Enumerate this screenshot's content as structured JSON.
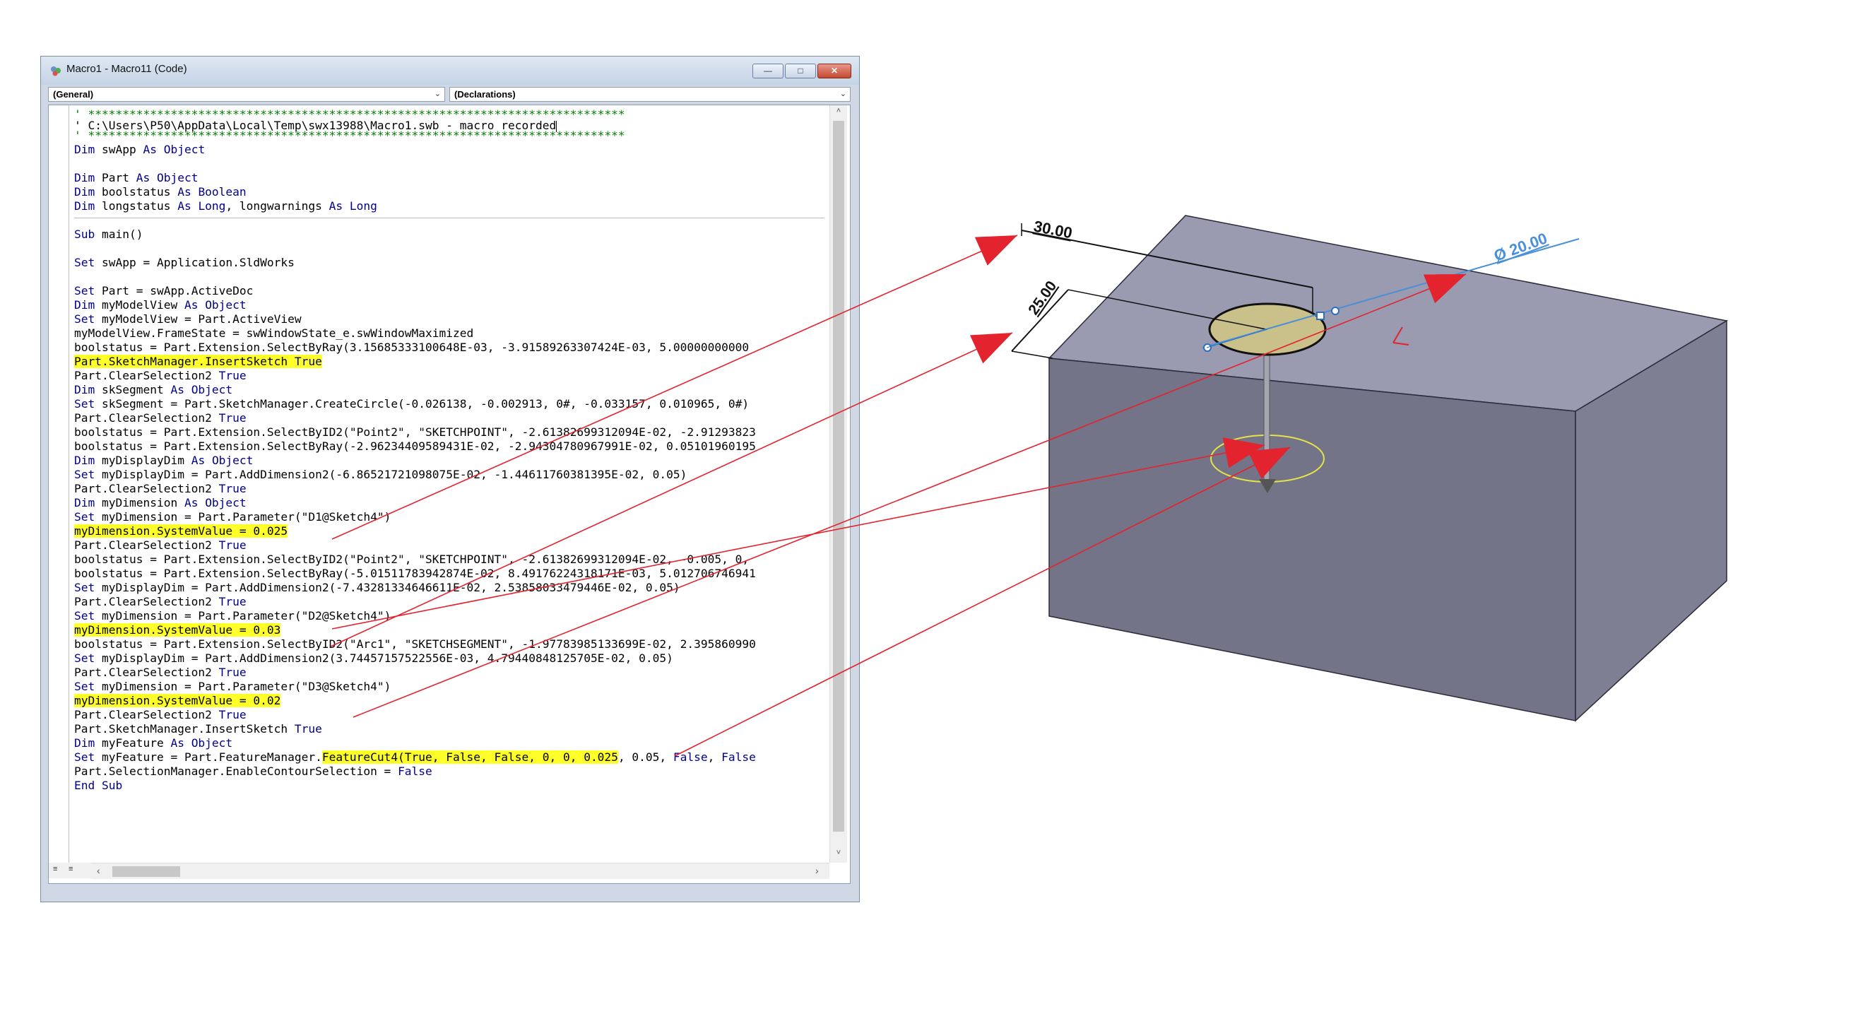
{
  "window": {
    "title": "Macro1 - Macro11 (Code)",
    "minimize_glyph": "—",
    "maximize_glyph": "□",
    "close_glyph": "✕",
    "object_combo": "(General)",
    "procedure_combo": "(Declarations)",
    "combo_arrow": "⌄"
  },
  "code_lines": [
    {
      "text": "' ******************************************************************************",
      "style": "comment"
    },
    {
      "text": "' C:\\Users\\P50\\AppData\\Local\\Temp\\swx13988\\Macro1.swb - macro recorded",
      "style": "plain",
      "cursor": true
    },
    {
      "text": "' ******************************************************************************",
      "style": "comment"
    },
    {
      "segments": [
        [
          "Dim",
          "kw"
        ],
        [
          " swApp ",
          ""
        ],
        [
          "As Object",
          "kw"
        ]
      ]
    },
    {
      "text": "",
      "style": "plain"
    },
    {
      "segments": [
        [
          "Dim",
          "kw"
        ],
        [
          " Part ",
          ""
        ],
        [
          "As Object",
          "kw"
        ]
      ]
    },
    {
      "segments": [
        [
          "Dim",
          "kw"
        ],
        [
          " boolstatus ",
          ""
        ],
        [
          "As Boolean",
          "kw"
        ]
      ]
    },
    {
      "segments": [
        [
          "Dim",
          "kw"
        ],
        [
          " longstatus ",
          ""
        ],
        [
          "As Long",
          "kw"
        ],
        [
          ", longwarnings ",
          ""
        ],
        [
          "As Long",
          "kw"
        ]
      ]
    },
    {
      "text": "",
      "style": "plain"
    },
    {
      "segments": [
        [
          "Sub",
          "kw"
        ],
        [
          " main()",
          ""
        ]
      ]
    },
    {
      "text": "",
      "style": "plain"
    },
    {
      "segments": [
        [
          "Set",
          "kw"
        ],
        [
          " swApp = Application.SldWorks",
          ""
        ]
      ]
    },
    {
      "text": "",
      "style": "plain"
    },
    {
      "segments": [
        [
          "Set",
          "kw"
        ],
        [
          " Part = swApp.ActiveDoc",
          ""
        ]
      ]
    },
    {
      "segments": [
        [
          "Dim",
          "kw"
        ],
        [
          " myModelView ",
          ""
        ],
        [
          "As Object",
          "kw"
        ]
      ]
    },
    {
      "segments": [
        [
          "Set",
          "kw"
        ],
        [
          " myModelView = Part.ActiveView",
          ""
        ]
      ]
    },
    {
      "text": "myModelView.FrameState = swWindowState_e.swWindowMaximized",
      "style": "plain"
    },
    {
      "text": "boolstatus = Part.Extension.SelectByRay(3.15685333100648E-03, -3.91589263307424E-03, 5.00000000000",
      "style": "plain"
    },
    {
      "segments": [
        [
          "Part.SketchManager.InsertSketch ",
          "hl"
        ],
        [
          "True",
          "hl kw"
        ]
      ]
    },
    {
      "segments": [
        [
          "Part.ClearSelection2 ",
          ""
        ],
        [
          "True",
          "kw"
        ]
      ]
    },
    {
      "segments": [
        [
          "Dim",
          "kw"
        ],
        [
          " skSegment ",
          ""
        ],
        [
          "As Object",
          "kw"
        ]
      ]
    },
    {
      "segments": [
        [
          "Set",
          "kw"
        ],
        [
          " skSegment = Part.SketchManager.CreateCircle(-0.026138, -0.002913, 0#, -0.033157, 0.010965, 0#)",
          ""
        ]
      ]
    },
    {
      "segments": [
        [
          "Part.ClearSelection2 ",
          ""
        ],
        [
          "True",
          "kw"
        ]
      ]
    },
    {
      "text": "boolstatus = Part.Extension.SelectByID2(\"Point2\", \"SKETCHPOINT\", -2.61382699312094E-02, -2.91293823",
      "style": "plain"
    },
    {
      "text": "boolstatus = Part.Extension.SelectByRay(-2.96234409589431E-02, -2.94304780967991E-02, 0.05101960195",
      "style": "plain"
    },
    {
      "segments": [
        [
          "Dim",
          "kw"
        ],
        [
          " myDisplayDim ",
          ""
        ],
        [
          "As Object",
          "kw"
        ]
      ]
    },
    {
      "segments": [
        [
          "Set",
          "kw"
        ],
        [
          " myDisplayDim = Part.AddDimension2(-6.86521721098075E-02, -1.44611760381395E-02, 0.05)",
          ""
        ]
      ]
    },
    {
      "segments": [
        [
          "Part.ClearSelection2 ",
          ""
        ],
        [
          "True",
          "kw"
        ]
      ]
    },
    {
      "segments": [
        [
          "Dim",
          "kw"
        ],
        [
          " myDimension ",
          ""
        ],
        [
          "As Object",
          "kw"
        ]
      ]
    },
    {
      "segments": [
        [
          "Set",
          "kw"
        ],
        [
          " myDimension = Part.Parameter(\"D1@Sketch4\")",
          ""
        ]
      ]
    },
    {
      "segments": [
        [
          "myDimension.SystemValue = 0.025",
          "hl"
        ]
      ]
    },
    {
      "segments": [
        [
          "Part.ClearSelection2 ",
          ""
        ],
        [
          "True",
          "kw"
        ]
      ]
    },
    {
      "text": "boolstatus = Part.Extension.SelectByID2(\"Point2\", \"SKETCHPOINT\", -2.61382699312094E-02, -0.005, 0,",
      "style": "plain"
    },
    {
      "text": "boolstatus = Part.Extension.SelectByRay(-5.01511783942874E-02, 8.49176224318171E-03, 5.012706746941",
      "style": "plain"
    },
    {
      "segments": [
        [
          "Set",
          "kw"
        ],
        [
          " myDisplayDim = Part.AddDimension2(-7.43281334646611E-02, 2.53858033479446E-02, 0.05)",
          ""
        ]
      ]
    },
    {
      "segments": [
        [
          "Part.ClearSelection2 ",
          ""
        ],
        [
          "True",
          "kw"
        ]
      ]
    },
    {
      "segments": [
        [
          "Set",
          "kw"
        ],
        [
          " myDimension = Part.Parameter(\"D2@Sketch4\")",
          ""
        ]
      ]
    },
    {
      "segments": [
        [
          "myDimension.SystemValue = 0.03",
          "hl"
        ]
      ]
    },
    {
      "text": "boolstatus = Part.Extension.SelectByID2(\"Arc1\", \"SKETCHSEGMENT\", -1.97783985133699E-02, 2.395860990",
      "style": "plain"
    },
    {
      "segments": [
        [
          "Set",
          "kw"
        ],
        [
          " myDisplayDim = Part.AddDimension2(3.74457157522556E-03, 4.79440848125705E-02, 0.05)",
          ""
        ]
      ]
    },
    {
      "segments": [
        [
          "Part.ClearSelection2 ",
          ""
        ],
        [
          "True",
          "kw"
        ]
      ]
    },
    {
      "segments": [
        [
          "Set",
          "kw"
        ],
        [
          " myDimension = Part.Parameter(\"D3@Sketch4\")",
          ""
        ]
      ]
    },
    {
      "segments": [
        [
          "myDimension.SystemValue = 0.02",
          "hl"
        ]
      ]
    },
    {
      "segments": [
        [
          "Part.ClearSelection2 ",
          ""
        ],
        [
          "True",
          "kw"
        ]
      ]
    },
    {
      "segments": [
        [
          "Part.SketchManager.InsertSketch ",
          ""
        ],
        [
          "True",
          "kw"
        ]
      ]
    },
    {
      "segments": [
        [
          "Dim",
          "kw"
        ],
        [
          " myFeature ",
          ""
        ],
        [
          "As Object",
          "kw"
        ]
      ]
    },
    {
      "segments": [
        [
          "Set",
          "kw"
        ],
        [
          " myFeature = Part.FeatureManager.",
          ""
        ],
        [
          "FeatureCut4(True, False, False, 0, 0, 0.025",
          "hl"
        ],
        [
          ", 0.05, ",
          ""
        ],
        [
          "False",
          "kw"
        ],
        [
          ", ",
          ""
        ],
        [
          "False",
          "kw"
        ]
      ]
    },
    {
      "segments": [
        [
          "Part.SelectionManager.EnableContourSelection = ",
          ""
        ],
        [
          "False",
          "kw"
        ]
      ]
    },
    {
      "segments": [
        [
          "End Sub",
          "kw"
        ]
      ]
    }
  ],
  "scrollbar": {
    "up": "˄",
    "down": "˅",
    "left": "‹",
    "right": "›",
    "view_procedure": "≡",
    "view_module": "≡"
  },
  "cad": {
    "dim_30": "30.00",
    "dim_25": "25.00",
    "dim_dia": "Ø 20.00",
    "colors": {
      "block_top": "#9a9ab0",
      "block_front": "#737488",
      "block_right": "#7e7f93",
      "circle_fill": "#c9c08a",
      "arrow": "#e3232d",
      "diameter_line": "#4a90d9"
    }
  }
}
